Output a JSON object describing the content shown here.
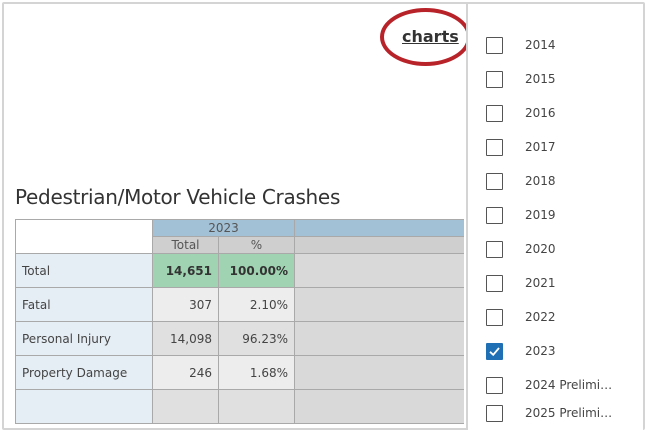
{
  "header": {
    "charts_link": "charts"
  },
  "report": {
    "title": "Pedestrian/Motor Vehicle Crashes",
    "year_header": "2023",
    "columns": [
      "Total",
      "%"
    ],
    "rows": [
      {
        "label": "Total",
        "total": "14,651",
        "pct": "100.00%"
      },
      {
        "label": "Fatal",
        "total": "307",
        "pct": "2.10%"
      },
      {
        "label": "Personal Injury",
        "total": "14,098",
        "pct": "96.23%"
      },
      {
        "label": "Property Damage",
        "total": "246",
        "pct": "1.68%"
      }
    ]
  },
  "year_filter": {
    "items": [
      {
        "label": "2014",
        "checked": false
      },
      {
        "label": "2015",
        "checked": false
      },
      {
        "label": "2016",
        "checked": false
      },
      {
        "label": "2017",
        "checked": false
      },
      {
        "label": "2018",
        "checked": false
      },
      {
        "label": "2019",
        "checked": false
      },
      {
        "label": "2020",
        "checked": false
      },
      {
        "label": "2021",
        "checked": false
      },
      {
        "label": "2022",
        "checked": false
      },
      {
        "label": "2023",
        "checked": true
      },
      {
        "label": "2024 Prelimi…",
        "checked": false
      },
      {
        "label": "2025 Prelimi…",
        "checked": false
      }
    ]
  },
  "colors": {
    "highlight": "#b8232a",
    "year_header_bg": "#a3c1d6",
    "total_highlight_bg": "#9fd3b1",
    "checkbox_checked": "#1f6fb5"
  }
}
